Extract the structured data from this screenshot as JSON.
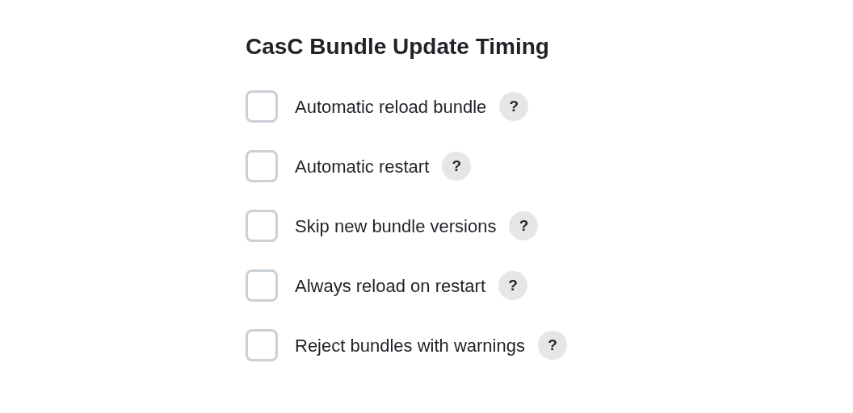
{
  "title": "CasC Bundle Update Timing",
  "options": [
    {
      "label": "Automatic reload bundle",
      "checked": false,
      "help": "?"
    },
    {
      "label": "Automatic restart",
      "checked": false,
      "help": "?"
    },
    {
      "label": "Skip new bundle versions",
      "checked": false,
      "help": "?"
    },
    {
      "label": "Always reload on restart",
      "checked": false,
      "help": "?"
    },
    {
      "label": "Reject bundles with warnings",
      "checked": false,
      "help": "?"
    }
  ]
}
